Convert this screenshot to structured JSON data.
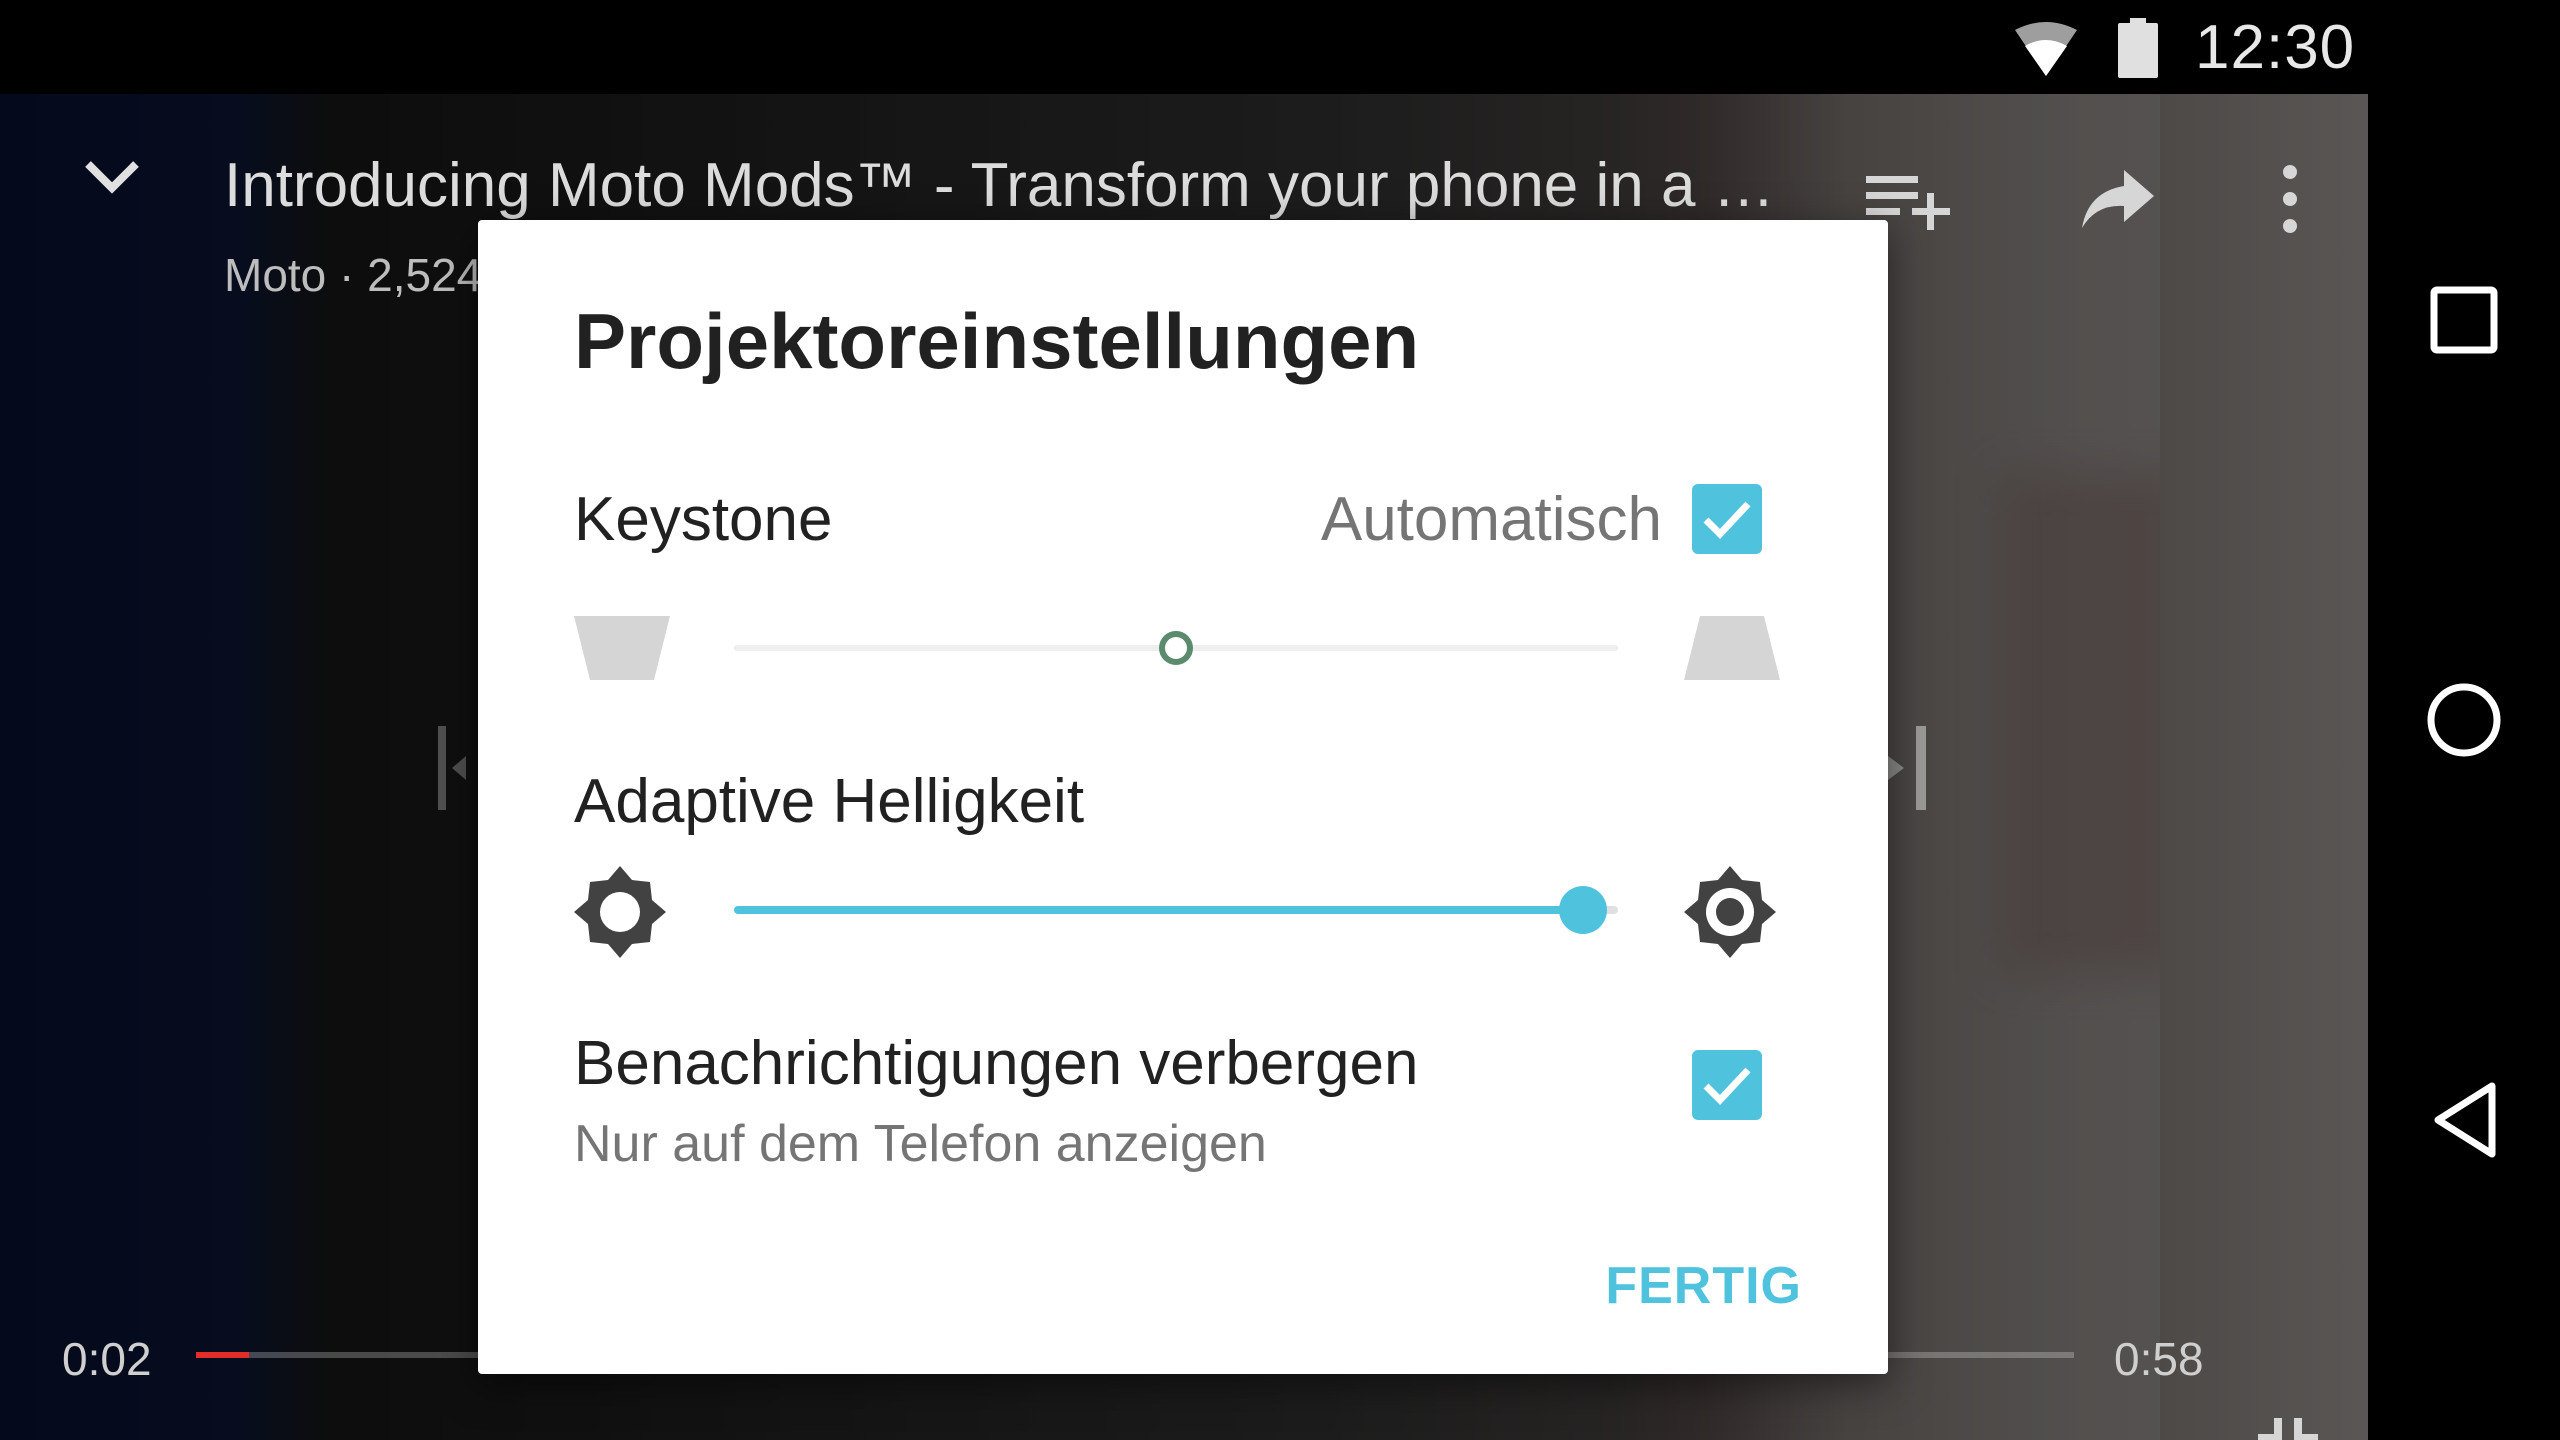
{
  "status_bar": {
    "time": "12:30",
    "icons": [
      "wifi-icon",
      "battery-icon"
    ]
  },
  "player": {
    "title": "Introducing Moto Mods™ - Transform your phone in a …",
    "meta": "Moto · 2,524",
    "time_current": "0:02",
    "time_total": "0:58",
    "progress": 0.028,
    "icons": [
      "chevron-down-icon",
      "add-to-queue-icon",
      "share-icon",
      "more-vert-icon",
      "previous-icon",
      "next-icon",
      "exit-fullscreen-icon"
    ]
  },
  "dialog": {
    "title": "Projektoreinstellungen",
    "keystone": {
      "label": "Keystone",
      "auto_label": "Automatisch",
      "auto_checked": true,
      "value": 0.5
    },
    "brightness": {
      "label": "Adaptive Helligkeit",
      "value": 0.96
    },
    "notifications": {
      "label": "Benachrichtigungen verbergen",
      "sublabel": "Nur auf dem Telefon anzeigen",
      "checked": true
    },
    "done_label": "FERTIG"
  },
  "nav_bar": {
    "icons": [
      "recents-icon",
      "home-icon",
      "back-icon"
    ]
  },
  "colors": {
    "accent": "#4fc3de",
    "progress": "#e52d27",
    "keystone_thumb": "#5b8b6c"
  }
}
